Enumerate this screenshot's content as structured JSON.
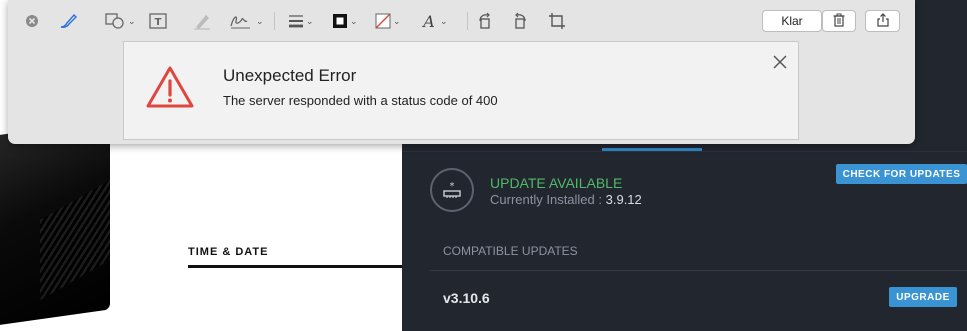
{
  "toolbar": {
    "tools": [
      {
        "name": "close-icon"
      },
      {
        "name": "sketch-pen-icon"
      },
      {
        "name": "shapes-icon"
      },
      {
        "name": "text-box-icon"
      },
      {
        "name": "highlight-icon"
      },
      {
        "name": "signature-icon"
      },
      {
        "name": "line-style-icon"
      },
      {
        "name": "border-color-icon"
      },
      {
        "name": "fill-color-icon"
      },
      {
        "name": "text-style-icon"
      },
      {
        "name": "rotate-left-icon"
      },
      {
        "name": "rotate-right-icon"
      },
      {
        "name": "crop-icon"
      }
    ],
    "done_label": "Klar",
    "delete_icon": "trash-icon",
    "share_icon": "share-icon",
    "accent_color": "#2a6fdb"
  },
  "error": {
    "title": "Unexpected Error",
    "message": "The server responded with a status code of 400",
    "icon": "warning-triangle-icon",
    "icon_color": "#e0463e"
  },
  "background": {
    "section_label": "TIME & DATE"
  },
  "updates": {
    "status_title": "UPDATE AVAILABLE",
    "status_color": "#52b96a",
    "installed_prefix": "Currently Installed :",
    "installed_version": "3.9.12",
    "check_button": "CHECK FOR UPDATES",
    "compatible_label": "COMPATIBLE UPDATES",
    "available": [
      {
        "version": "v3.10.6",
        "action": "UPGRADE"
      }
    ],
    "button_color": "#3a94d3"
  }
}
